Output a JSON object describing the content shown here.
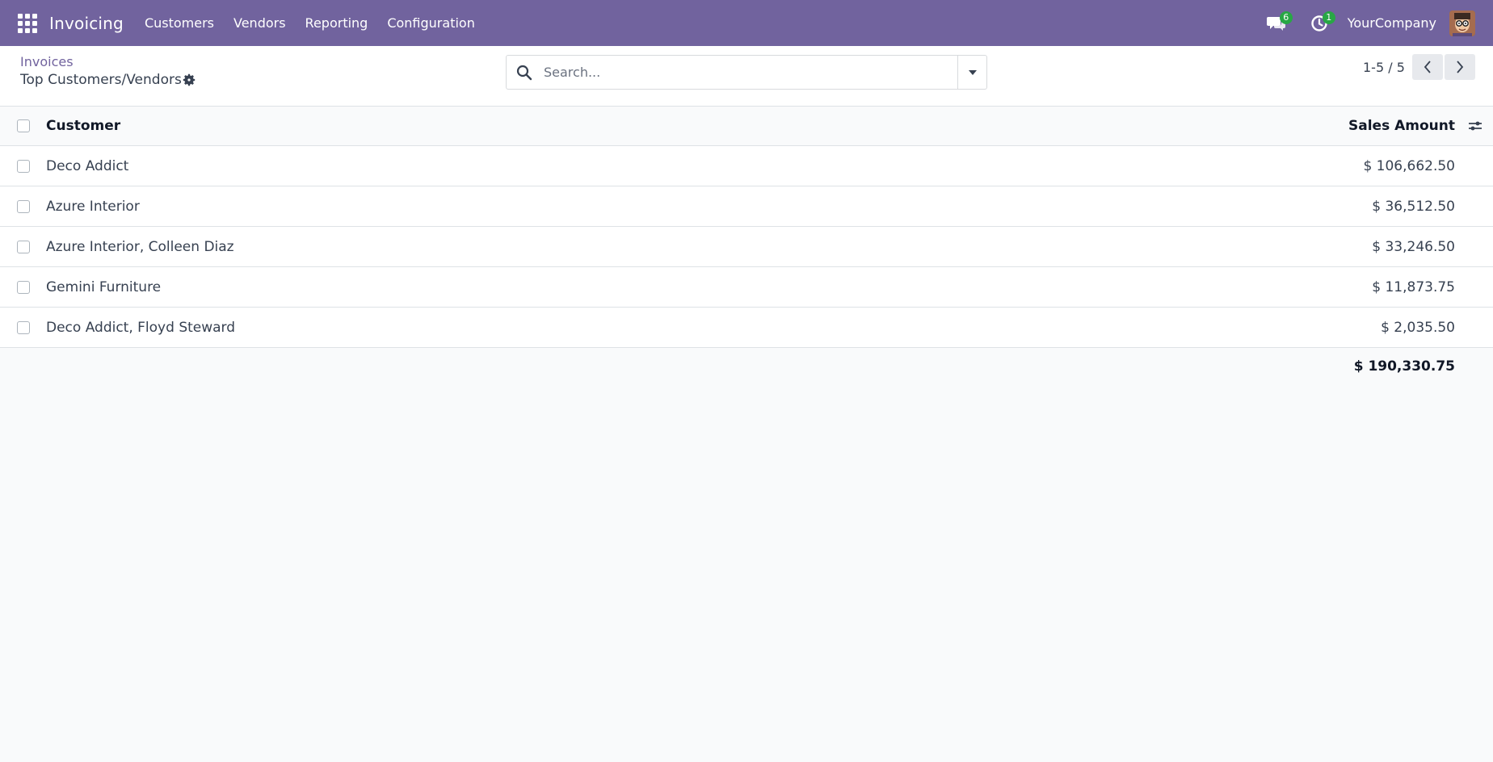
{
  "navbar": {
    "app_name": "Invoicing",
    "menu": [
      {
        "label": "Customers"
      },
      {
        "label": "Vendors"
      },
      {
        "label": "Reporting"
      },
      {
        "label": "Configuration"
      }
    ],
    "messages_count": "6",
    "activities_count": "1",
    "company": "YourCompany"
  },
  "control_panel": {
    "breadcrumb": "Invoices",
    "title": "Top Customers/Vendors",
    "search_placeholder": "Search...",
    "pager": "1-5 / 5"
  },
  "table": {
    "headers": {
      "customer": "Customer",
      "amount": "Sales Amount"
    },
    "rows": [
      {
        "customer": "Deco Addict",
        "amount": "$ 106,662.50"
      },
      {
        "customer": "Azure Interior",
        "amount": "$ 36,512.50"
      },
      {
        "customer": "Azure Interior, Colleen Diaz",
        "amount": "$ 33,246.50"
      },
      {
        "customer": "Gemini Furniture",
        "amount": "$ 11,873.75"
      },
      {
        "customer": "Deco Addict, Floyd Steward",
        "amount": "$ 2,035.50"
      }
    ],
    "total": "$ 190,330.75"
  },
  "colors": {
    "brand": "#71639e",
    "badge": "#28a745"
  }
}
